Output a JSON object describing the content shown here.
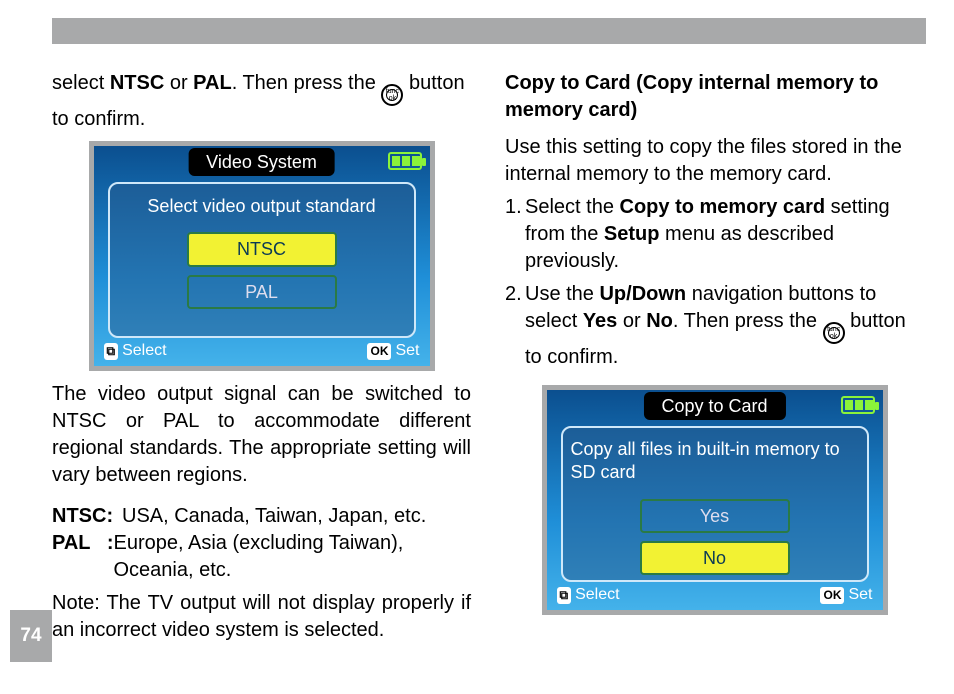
{
  "pageNumber": "74",
  "left": {
    "intro_pre": "select ",
    "intro_bold1": "NTSC",
    "intro_mid": " or ",
    "intro_bold2": "PAL",
    "intro_post": ". Then press the ",
    "intro_after_icon": " button to confirm.",
    "screen": {
      "title": "Video System",
      "panel_title": "Select video output standard",
      "option1": "NTSC",
      "option2": "PAL",
      "footer_select_key": "⧉",
      "footer_select": "Select",
      "footer_set_key": "OK",
      "footer_set": "Set"
    },
    "body": "The video output signal can be switched to NTSC or PAL to accommodate different regional standards. The appropriate setting will vary between regions.",
    "ntsc_label": "NTSC:",
    "ntsc_text": "USA, Canada, Taiwan, Japan, etc.",
    "pal_label": "PAL   :",
    "pal_text": "Europe, Asia (excluding Taiwan), Oceania, etc.",
    "note": "Note: The TV output will not display properly if an incorrect video system is selected."
  },
  "right": {
    "heading": "Copy to Card (Copy internal memory to memory card)",
    "intro": "Use this setting to copy the files stored in the internal memory to the memory card.",
    "step1_pre": "Select the ",
    "step1_b1": "Copy to memory card",
    "step1_mid": " setting from the ",
    "step1_b2": "Setup",
    "step1_post": " menu as described previously.",
    "step2_pre": "Use the ",
    "step2_b1": "Up/Down",
    "step2_mid": " navigation buttons to select ",
    "step2_b2": "Yes",
    "step2_or": " or ",
    "step2_b3": "No",
    "step2_post": ". Then press the ",
    "step2_after_icon": " button to confirm.",
    "screen": {
      "title": "Copy to Card",
      "panel_title": "Copy all files in built-in memory to SD card",
      "option1": "Yes",
      "option2": "No",
      "footer_select_key": "⧉",
      "footer_select": "Select",
      "footer_set_key": "OK",
      "footer_set": "Set"
    }
  },
  "func_icon_text": "func\nok"
}
